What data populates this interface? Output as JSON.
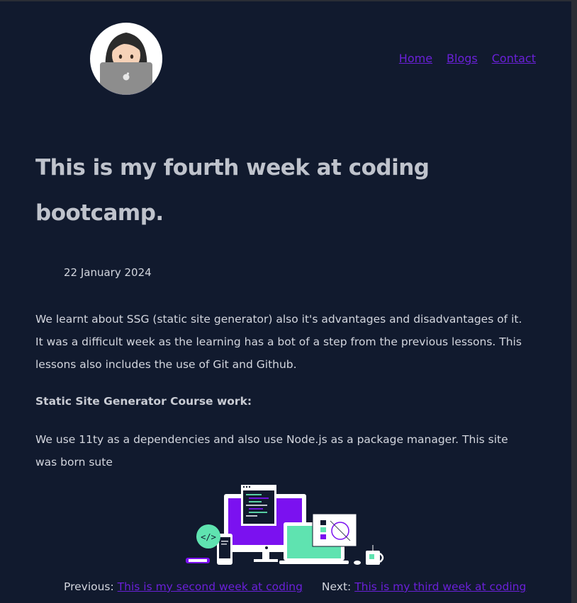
{
  "header": {
    "nav": [
      {
        "label": "Home"
      },
      {
        "label": "Blogs"
      },
      {
        "label": "Contact"
      }
    ]
  },
  "post": {
    "title": "This is my fourth week at coding bootcamp.",
    "date": "22 January 2024",
    "intro": "We learnt about SSG (static site generator) also it's advantages and disadvantages of it. It was a difficult week as the learning has a bot of a step from the previous lessons. This lessons also includes the use of Git and Github.",
    "subheading": "Static Site Generator Course work:",
    "body": "We use 11ty as a dependencies and also use Node.js as a package manager. This site was born sute",
    "illustration_icon": "devices-illustration-icon"
  },
  "pagination": {
    "previous_label": "Previous:",
    "previous_link": "This is my second week at coding",
    "next_label": "Next:",
    "next_link": "This is my third week at coding"
  },
  "colors": {
    "background": "#111a2e",
    "link": "#6a20d8",
    "accent_purple": "#7b11f0",
    "accent_green": "#5fe3b0"
  }
}
